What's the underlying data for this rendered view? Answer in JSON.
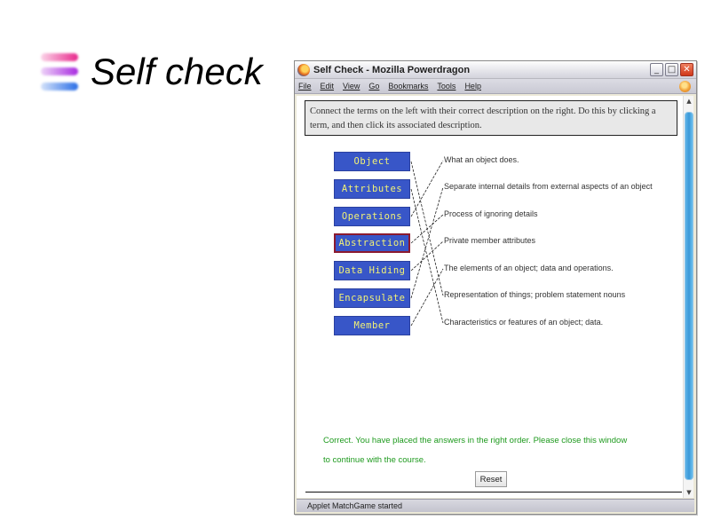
{
  "slide": {
    "title": "Self check"
  },
  "window": {
    "title_page": "Self Check",
    "title_separator": " - ",
    "title_app": "Mozilla Powerdragon",
    "controls": {
      "minimize": "_",
      "maximize": "□",
      "close": "✕"
    }
  },
  "menu": {
    "items": [
      "File",
      "Edit",
      "View",
      "Go",
      "Bookmarks",
      "Tools",
      "Help"
    ]
  },
  "instructions": "Connect the terms on the left with their correct description on the right. Do this by clicking a term, and then click its associated description.",
  "terms": [
    {
      "label": "Object",
      "selected": false
    },
    {
      "label": "Attributes",
      "selected": false
    },
    {
      "label": "Operations",
      "selected": false
    },
    {
      "label": "Abstraction",
      "selected": true
    },
    {
      "label": "Data Hiding",
      "selected": false
    },
    {
      "label": "Encapsulate",
      "selected": false
    },
    {
      "label": "Member",
      "selected": false
    }
  ],
  "descriptions": [
    "What an object does.",
    "Separate internal details from external aspects of an object",
    "Process of ignoring details",
    "Private member attributes",
    "The elements of an object; data and operations.",
    "Representation of things; problem statement nouns",
    "Characteristics or features of an object; data."
  ],
  "matches": [
    {
      "term": 0,
      "description": 5
    },
    {
      "term": 1,
      "description": 6
    },
    {
      "term": 2,
      "description": 0
    },
    {
      "term": 3,
      "description": 2
    },
    {
      "term": 4,
      "description": 3
    },
    {
      "term": 5,
      "description": 1
    },
    {
      "term": 6,
      "description": 4
    }
  ],
  "result": {
    "line1": "Correct. You have placed the answers in the right order. Please close this window",
    "line2": "to continue with the course.",
    "color": "#1e9a1e"
  },
  "reset_label": "Reset",
  "status": "Applet MatchGame started",
  "colors": {
    "term_bg": "#3856c8",
    "term_text": "#f2f276",
    "selected_border": "#8b1a30"
  }
}
